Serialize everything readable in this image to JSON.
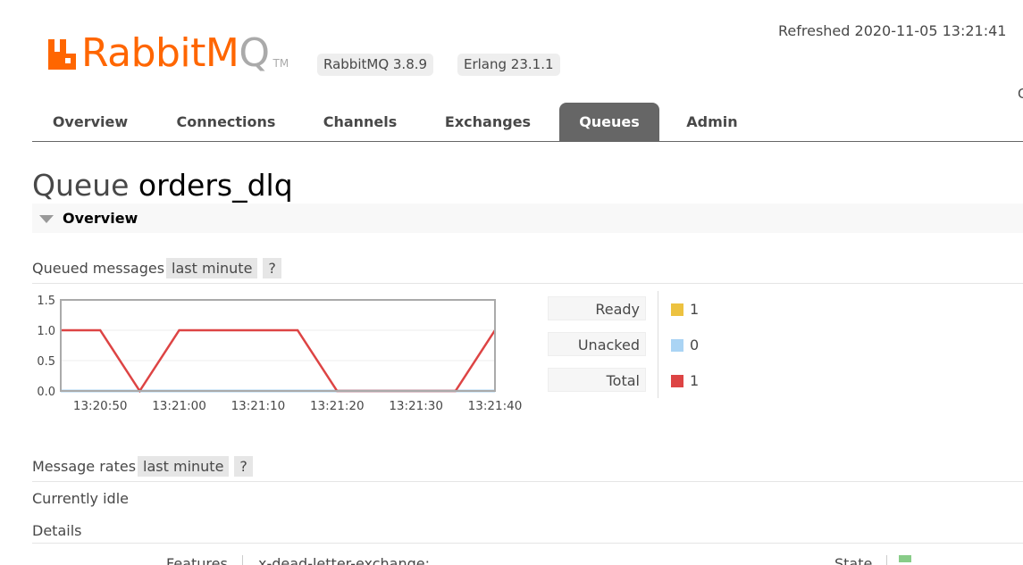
{
  "header": {
    "logo_word_main": "RabbitM",
    "logo_word_accent": "Q",
    "logo_tm": "TM",
    "brand_color": "#ff6600",
    "rabbitmq_version": "RabbitMQ 3.8.9",
    "erlang_version": "Erlang 23.1.1",
    "refreshed": "Refreshed 2020-11-05 13:21:41",
    "edge_letter": "C"
  },
  "nav": {
    "tabs": [
      {
        "label": "Overview"
      },
      {
        "label": "Connections"
      },
      {
        "label": "Channels"
      },
      {
        "label": "Exchanges"
      },
      {
        "label": "Queues",
        "active": true
      },
      {
        "label": "Admin"
      }
    ]
  },
  "page": {
    "title_prefix": "Queue",
    "queue_name": "orders_dlq",
    "overview_label": "Overview"
  },
  "queued_messages": {
    "label": "Queued messages",
    "range": "last minute",
    "help": "?"
  },
  "chart_data": {
    "type": "line",
    "title": "",
    "xlabel": "",
    "ylabel": "",
    "ylim": [
      0,
      1.5
    ],
    "yticks": [
      "0.0",
      "0.5",
      "1.0",
      "1.5"
    ],
    "xticks": [
      "13:20:50",
      "13:21:00",
      "13:21:10",
      "13:21:20",
      "13:21:30",
      "13:21:40"
    ],
    "grid": true,
    "series": [
      {
        "name": "Total",
        "color": "#dd4444",
        "points": [
          [
            "13:20:45",
            1
          ],
          [
            "13:20:50",
            1
          ],
          [
            "13:20:55",
            0
          ],
          [
            "13:21:00",
            1
          ],
          [
            "13:21:05",
            1
          ],
          [
            "13:21:10",
            1
          ],
          [
            "13:21:15",
            1
          ],
          [
            "13:21:20",
            0
          ],
          [
            "13:21:25",
            0
          ],
          [
            "13:21:30",
            0
          ],
          [
            "13:21:35",
            0
          ],
          [
            "13:21:40",
            1
          ]
        ]
      },
      {
        "name": "Unacked",
        "color": "#aad4f4",
        "points": [
          [
            "13:20:45",
            0
          ],
          [
            "13:21:40",
            0
          ]
        ]
      }
    ]
  },
  "legend": [
    {
      "label": "Ready",
      "value": "1",
      "color": "#edc240"
    },
    {
      "label": "Unacked",
      "value": "0",
      "color": "#aad4f4"
    },
    {
      "label": "Total",
      "value": "1",
      "color": "#dd4444"
    }
  ],
  "message_rates": {
    "label": "Message rates",
    "range": "last minute",
    "help": "?",
    "idle_text": "Currently idle"
  },
  "details": {
    "label": "Details",
    "features_label": "Features",
    "features_value": "x-dead-letter-exchange:",
    "state_label": "State"
  }
}
